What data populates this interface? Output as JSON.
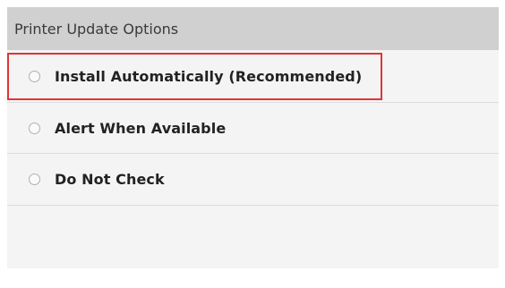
{
  "header": {
    "title": "Printer Update Options"
  },
  "options": [
    {
      "label": "Install Automatically (Recommended)",
      "selected": false,
      "highlighted": true
    },
    {
      "label": "Alert When Available",
      "selected": false,
      "highlighted": false
    },
    {
      "label": "Do Not Check",
      "selected": false,
      "highlighted": false
    }
  ],
  "colors": {
    "highlight_border": "#e03535",
    "header_background": "#d0d0d0",
    "panel_background": "#f4f4f4"
  }
}
